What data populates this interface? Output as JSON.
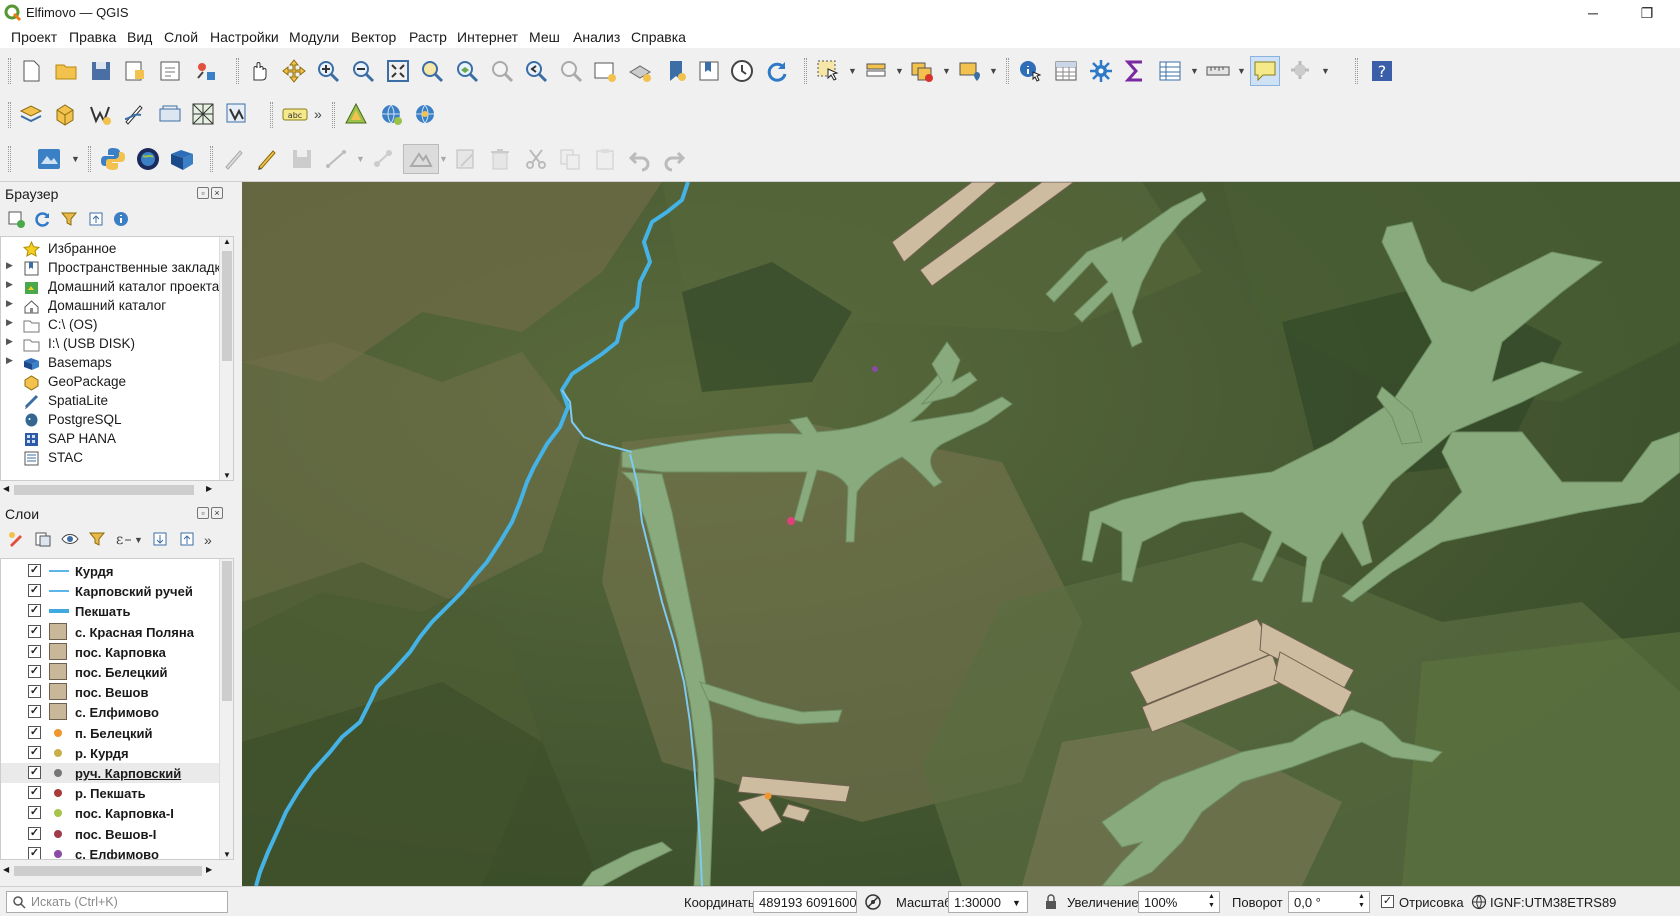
{
  "window": {
    "title": "Elfimovo — QGIS",
    "minimize": "─",
    "maximize": "❐"
  },
  "menu": [
    "Проект",
    "Правка",
    "Вид",
    "Слой",
    "Настройки",
    "Модули",
    "Вектор",
    "Растр",
    "Интернет",
    "Меш",
    "Анализ",
    "Справка"
  ],
  "browser": {
    "title": "Браузер",
    "items": [
      {
        "label": "Избранное",
        "icon": "star-icon"
      },
      {
        "label": "Пространственные закладки",
        "icon": "bookmark-icon"
      },
      {
        "label": "Домашний каталог проекта",
        "icon": "project-home-icon"
      },
      {
        "label": "Домашний каталог",
        "icon": "home-icon"
      },
      {
        "label": "C:\\ (OS)",
        "icon": "drive-icon"
      },
      {
        "label": "I:\\ (USB DISK)",
        "icon": "drive-icon"
      },
      {
        "label": "Basemaps",
        "icon": "basemap-icon"
      },
      {
        "label": "GeoPackage",
        "icon": "geopackage-icon"
      },
      {
        "label": "SpatiaLite",
        "icon": "spatialite-icon"
      },
      {
        "label": "PostgreSQL",
        "icon": "postgresql-icon"
      },
      {
        "label": "SAP HANA",
        "icon": "sap-hana-icon"
      },
      {
        "label": "STAC",
        "icon": "stac-icon"
      }
    ]
  },
  "layers": {
    "title": "Слои",
    "items": [
      {
        "label": "Курдя",
        "symbol": "line",
        "color": "#5bb6e8",
        "checked": true
      },
      {
        "label": "Карповский ручей",
        "symbol": "line",
        "color": "#5bb6e8",
        "checked": true
      },
      {
        "label": "Пекшать",
        "symbol": "line-thick",
        "color": "#3fa9e0",
        "checked": true
      },
      {
        "label": "с. Красная Поляна",
        "symbol": "fill",
        "color": "#c9b79a",
        "checked": true
      },
      {
        "label": "пос. Карповка",
        "symbol": "fill",
        "color": "#c9b79a",
        "checked": true
      },
      {
        "label": "пос. Белецкий",
        "symbol": "fill",
        "color": "#c9b79a",
        "checked": true
      },
      {
        "label": "пос. Вешов",
        "symbol": "fill",
        "color": "#c9b79a",
        "checked": true
      },
      {
        "label": "с. Елфимово",
        "symbol": "fill",
        "color": "#c9b79a",
        "checked": true
      },
      {
        "label": "п. Белецкий",
        "symbol": "point",
        "color": "#f0962e",
        "checked": true
      },
      {
        "label": "р. Курдя",
        "symbol": "point",
        "color": "#c8b04a",
        "checked": true
      },
      {
        "label": "руч. Карповский",
        "symbol": "point",
        "color": "#777777",
        "checked": true,
        "selected": true
      },
      {
        "label": "р. Пекшать",
        "symbol": "point",
        "color": "#a83a3a",
        "checked": true
      },
      {
        "label": "пос. Карповка-I",
        "symbol": "point",
        "color": "#a7c44a",
        "checked": true
      },
      {
        "label": "пос. Вешов-I",
        "symbol": "point",
        "color": "#9e3a4a",
        "checked": true
      },
      {
        "label": "с. Елфимово",
        "symbol": "point",
        "color": "#8a4aa8",
        "checked": true
      }
    ]
  },
  "status": {
    "search_placeholder": "Искать (Ctrl+K)",
    "coords_label": "Координаты",
    "coords_value": "489193  6091600",
    "scale_label": "Масштаб",
    "scale_value": "1:30000",
    "magnifier_label": "Увеличение",
    "magnifier_value": "100%",
    "rotation_label": "Поворот",
    "rotation_value": "0,0 °",
    "render_label": "Отрисовка",
    "crs_label": "IGNF:UTM38ETRS89"
  },
  "colors": {
    "river": "#45b3e6",
    "ravine_fill": "#88aa7c",
    "settlement_fill": "#cdbca0",
    "accent": "#3b7fc4"
  }
}
